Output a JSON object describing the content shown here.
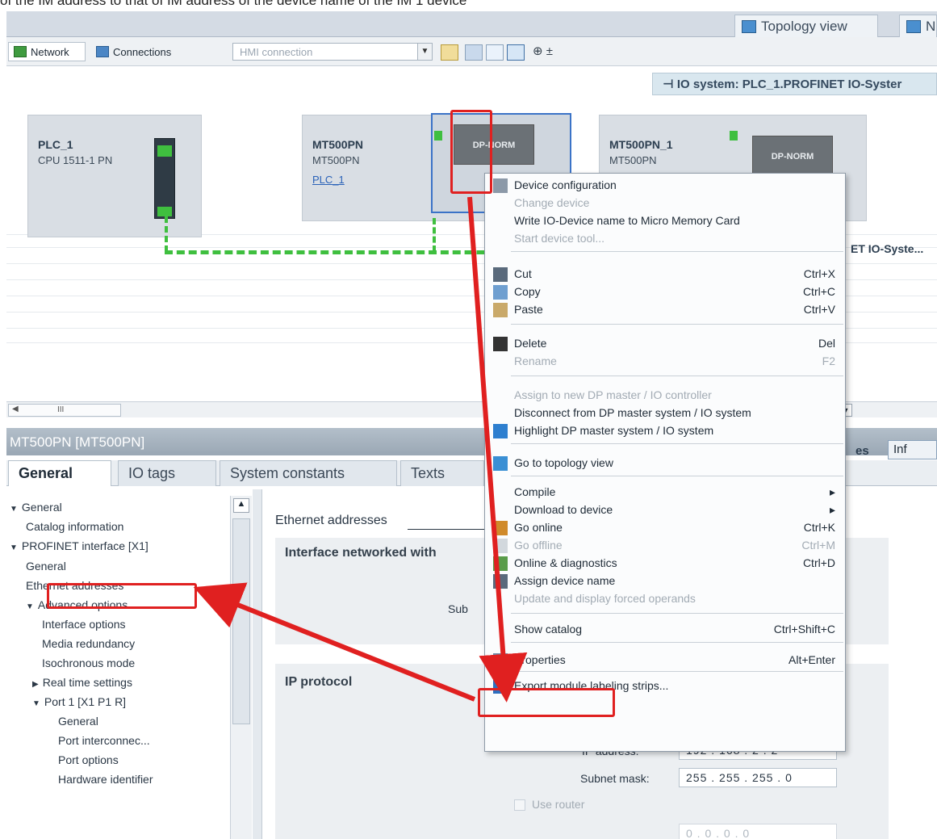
{
  "caption": "of the IM address to that of IM address of the device name of the IM 1 device",
  "view_tabs": {
    "topology": "Topology view",
    "network": "N"
  },
  "toolbar": {
    "network": "Network",
    "connections": "Connections",
    "hmi_connection": "HMI connection",
    "zoom": "⊕ ±"
  },
  "io_system": "IO system: PLC_1.PROFINET IO-Syster",
  "devices": [
    {
      "name": "PLC_1",
      "type": "CPU 1511-1 PN",
      "link": ""
    },
    {
      "name": "MT500PN",
      "type": "MT500PN",
      "link": "PLC_1",
      "module": "DP-NORM"
    },
    {
      "name": "MT500PN_1",
      "type": "MT500PN",
      "link": "",
      "module": "DP-NORM"
    }
  ],
  "network_label": "ET IO-Syste...",
  "scroll_marker": "III",
  "inspector": {
    "title": "MT500PN [MT500PN]",
    "right_tabs": [
      "es",
      "Inf"
    ],
    "tabs": [
      "General",
      "IO tags",
      "System constants",
      "Texts"
    ],
    "tree": [
      {
        "label": "General",
        "arrow": "▼"
      },
      {
        "label": "Catalog information"
      },
      {
        "label": "PROFINET interface [X1]",
        "arrow": "▼"
      },
      {
        "label": "General"
      },
      {
        "label": "Ethernet addresses"
      },
      {
        "label": "Advanced options",
        "arrow": "▼"
      },
      {
        "label": "Interface options"
      },
      {
        "label": "Media redundancy"
      },
      {
        "label": "Isochronous mode"
      },
      {
        "label": "Real time settings",
        "arrow": "▶"
      },
      {
        "label": "Port 1 [X1 P1 R]",
        "arrow": "▼"
      },
      {
        "label": "General"
      },
      {
        "label": "Port interconnec..."
      },
      {
        "label": "Port options"
      },
      {
        "label": "Hardware identifier"
      }
    ],
    "props": {
      "ethernet_heading": "Ethernet addresses",
      "interface_section": "Interface networked with",
      "sub_label": "Sub",
      "ip_section": "IP protocol",
      "ip_address_label": "IP address:",
      "ip_address": "192 . 168 . 2   . 2",
      "subnet_label": "Subnet mask:",
      "subnet": "255 . 255 . 255 . 0",
      "use_router": "Use router",
      "router_address": "0 . 0 . 0 . 0"
    }
  },
  "context_menu": [
    {
      "label": "Device configuration",
      "shortcut": "",
      "enabled": true,
      "icon": "device-config-icon"
    },
    {
      "label": "Change device",
      "shortcut": "",
      "enabled": false
    },
    {
      "label": "Write IO-Device name to Micro Memory Card",
      "shortcut": "",
      "enabled": true
    },
    {
      "label": "Start device tool...",
      "shortcut": "",
      "enabled": false
    },
    {
      "label": "Cut",
      "shortcut": "Ctrl+X",
      "enabled": true,
      "icon": "scissors-icon"
    },
    {
      "label": "Copy",
      "shortcut": "Ctrl+C",
      "enabled": true,
      "icon": "copy-icon"
    },
    {
      "label": "Paste",
      "shortcut": "Ctrl+V",
      "enabled": true,
      "icon": "paste-icon"
    },
    {
      "label": "Delete",
      "shortcut": "Del",
      "enabled": true,
      "icon": "delete-icon"
    },
    {
      "label": "Rename",
      "shortcut": "F2",
      "enabled": false
    },
    {
      "label": "Assign to new DP master / IO controller",
      "shortcut": "",
      "enabled": false
    },
    {
      "label": "Disconnect from DP master system / IO system",
      "shortcut": "",
      "enabled": true
    },
    {
      "label": "Highlight DP master system / IO system",
      "shortcut": "",
      "enabled": true,
      "icon": "checkbox-checked-icon"
    },
    {
      "label": "Go to topology view",
      "shortcut": "",
      "enabled": true,
      "icon": "topology-icon"
    },
    {
      "label": "Compile",
      "shortcut": "▸",
      "enabled": true
    },
    {
      "label": "Download to device",
      "shortcut": "▸",
      "enabled": true
    },
    {
      "label": "Go online",
      "shortcut": "Ctrl+K",
      "enabled": true,
      "icon": "go-online-icon"
    },
    {
      "label": "Go offline",
      "shortcut": "Ctrl+M",
      "enabled": false,
      "icon": "go-offline-icon"
    },
    {
      "label": "Online & diagnostics",
      "shortcut": "Ctrl+D",
      "enabled": true,
      "icon": "diagnostics-icon"
    },
    {
      "label": "Assign device name",
      "shortcut": "",
      "enabled": true,
      "icon": "assign-name-icon"
    },
    {
      "label": "Update and display forced operands",
      "shortcut": "",
      "enabled": false
    },
    {
      "label": "Show catalog",
      "shortcut": "Ctrl+Shift+C",
      "enabled": true
    },
    {
      "label": "Properties",
      "shortcut": "Alt+Enter",
      "enabled": true,
      "icon": "properties-icon"
    },
    {
      "label": "Export module labeling strips...",
      "shortcut": "",
      "enabled": true,
      "icon": "export-icon"
    }
  ],
  "colors": {
    "highlight_red": "#e02020",
    "accent_blue": "#4a8fcf",
    "link_green": "#3fbf3f"
  }
}
